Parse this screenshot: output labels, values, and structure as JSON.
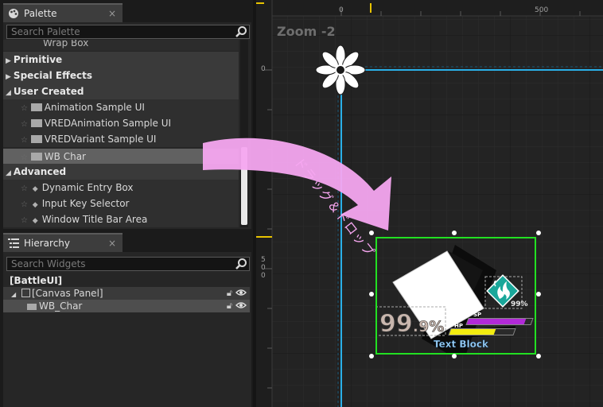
{
  "palette": {
    "tab_label": "Palette",
    "close": "×",
    "search_placeholder": "Search Palette",
    "clipped_item": "Wrap Box",
    "categories": {
      "primitive": "Primitive",
      "special_effects": "Special Effects",
      "user_created": "User Created",
      "advanced": "Advanced"
    },
    "user_items": [
      "Animation Sample UI",
      "VREDAnimation Sample UI",
      "VREDVariant Sample UI",
      "WB Char"
    ],
    "advanced_items": [
      "Dynamic Entry Box",
      "Input Key Selector",
      "Window Title Bar Area"
    ]
  },
  "hierarchy": {
    "tab_label": "Hierarchy",
    "close": "×",
    "search_placeholder": "Search Widgets",
    "root": "[BattleUI]",
    "canvas": "[Canvas Panel]",
    "child": "WB_Char"
  },
  "designer": {
    "zoom_label": "Zoom -2",
    "ruler_top": [
      "0",
      "500"
    ],
    "ruler_left": [
      "0",
      "5",
      "0",
      "0"
    ],
    "annotation": "ドラッグ＆ドロップ",
    "widget": {
      "big_percent": "99",
      "big_percent_suffix": ".9%",
      "small_percent": "99%",
      "sp_label": "SP",
      "hp_label": "HP",
      "text_block": "Text Block",
      "sp_level": 0.9,
      "hp_level": 0.7
    }
  },
  "colors": {
    "selection": "#22e022",
    "guide": "#2ab0e8",
    "arrow": "#f6a6f0",
    "sp_bar": "#b22ad8",
    "hp_bar": "#f2ec10",
    "emblem": "#1aa79a"
  }
}
